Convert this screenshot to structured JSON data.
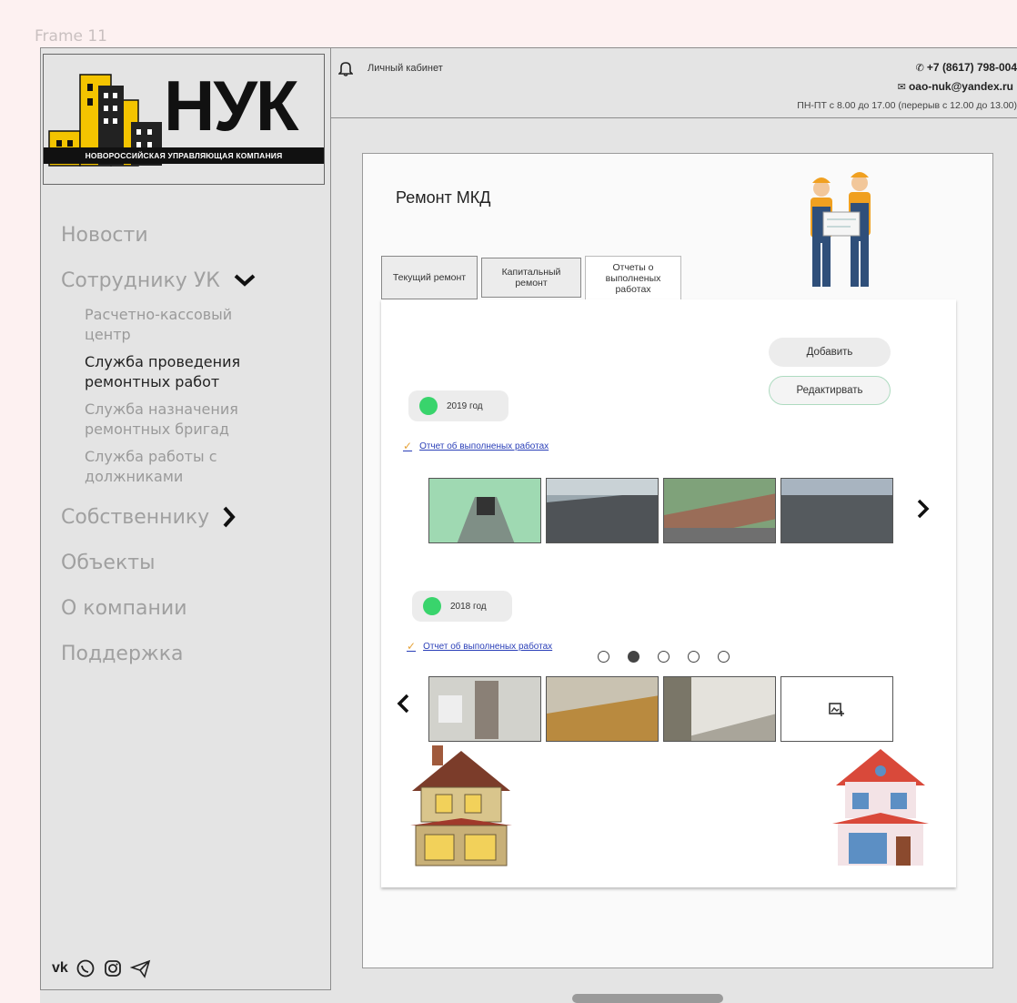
{
  "frame_label": "Frame 11",
  "logo": {
    "word": "НУК",
    "strip": "НОВОРОССИЙСКАЯ УПРАВЛЯЮЩАЯ КОМПАНИЯ"
  },
  "nav": {
    "items": [
      {
        "label": "Новости"
      },
      {
        "label": "Сотруднику УК",
        "icon": "chevron-down-icon"
      },
      {
        "label": "Собственнику",
        "icon": "chevron-right-icon"
      },
      {
        "label": "Объекты"
      },
      {
        "label": "О компании"
      },
      {
        "label": "Поддержка"
      }
    ],
    "sub_items": [
      {
        "line1": "Расчетно-кассовый",
        "line2": "центр",
        "active": false
      },
      {
        "line1": "Служба проведения",
        "line2": "ремонтных работ",
        "active": true
      },
      {
        "line1": "Служба назначения",
        "line2": "ремонтных бригад",
        "active": false
      },
      {
        "line1": "Служба работы с",
        "line2": "должниками",
        "active": false
      }
    ]
  },
  "socials": [
    "vk-icon",
    "whatsapp-icon",
    "instagram-icon",
    "telegram-icon"
  ],
  "topbar": {
    "cabinet": "Личный кабинет",
    "phone": "+7 (8617) 798-004",
    "email": "oao-nuk@yandex.ru",
    "hours": "ПН-ПТ с 8.00 до 17.00 (перерыв с 12.00 до 13.00)"
  },
  "main": {
    "title": "Ремонт МКД",
    "tabs": [
      {
        "line1": "Текущий ремонт",
        "line2": "",
        "line3": ""
      },
      {
        "line1": "Капитальный",
        "line2": "ремонт",
        "line3": ""
      },
      {
        "line1": "Отчеты о",
        "line2": "выполненых",
        "line3": "работах"
      }
    ],
    "add_label": "Добавить",
    "edit_label": "Редактирвать",
    "groups": [
      {
        "year": "2019 год",
        "report": "Отчет об выполненых работах"
      },
      {
        "year": "2018 год",
        "report": "Отчет об выполненых работах"
      }
    ],
    "pagination": {
      "count": 5,
      "active": 2
    },
    "colors": {
      "status_dot": "#39d46c",
      "link": "#2a3fb8",
      "check": "#e6a43a"
    }
  }
}
